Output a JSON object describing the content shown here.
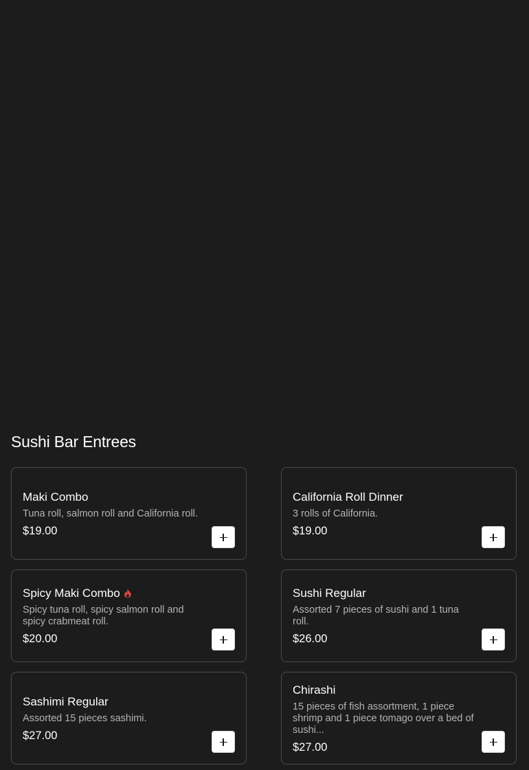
{
  "section": {
    "title": "Sushi Bar Entrees"
  },
  "items": [
    {
      "name": "Maki Combo",
      "description": "Tuna roll, salmon roll and California roll.",
      "price": "$19.00",
      "spicy": false
    },
    {
      "name": "California Roll Dinner",
      "description": "3 rolls of California.",
      "price": "$19.00",
      "spicy": false
    },
    {
      "name": "Spicy Maki Combo",
      "description": "Spicy tuna roll, spicy salmon roll and spicy crabmeat roll.",
      "price": "$20.00",
      "spicy": true
    },
    {
      "name": "Sushi Regular",
      "description": "Assorted 7 pieces of sushi and 1 tuna roll.",
      "price": "$26.00",
      "spicy": false
    },
    {
      "name": "Sashimi Regular",
      "description": "Assorted 15 pieces sashimi.",
      "price": "$27.00",
      "spicy": false
    },
    {
      "name": "Chirashi",
      "description": "15 pieces of fish assortment, 1 piece shrimp and 1 piece tomago over a bed of sushi...",
      "price": "$27.00",
      "spicy": false
    }
  ],
  "icons": {
    "add": "plus-icon",
    "spicy": "flame-icon"
  },
  "colors": {
    "background": "#1c1c1d",
    "card_border": "#4a4a4c",
    "spicy": "#e0443e",
    "description": "#b4b4b6"
  }
}
